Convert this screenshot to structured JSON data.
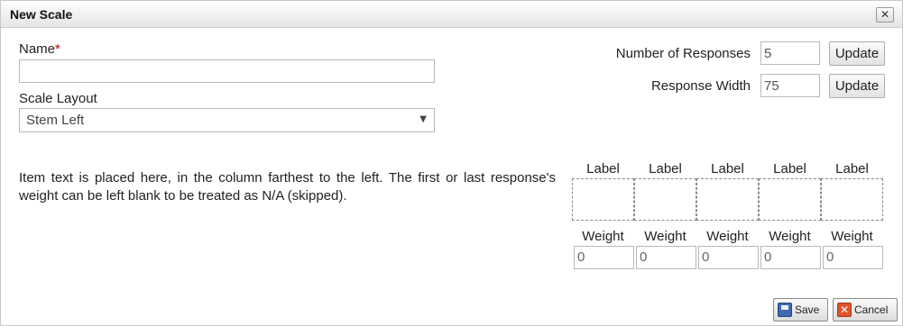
{
  "dialog": {
    "title": "New Scale",
    "close_glyph": "✕"
  },
  "form": {
    "name_label": "Name",
    "required_marker": "*",
    "name_value": "",
    "layout_label": "Scale Layout",
    "layout_selected": "Stem Left",
    "layout_caret": "▼"
  },
  "settings": {
    "responses_label": "Number of Responses",
    "responses_value": "5",
    "width_label": "Response Width",
    "width_value": "75",
    "update_label": "Update"
  },
  "description": "Item text is placed here, in the column farthest to the left. The first or last response's weight can be left blank to be treated as N/A (skipped).",
  "responses": {
    "label_header": "Label",
    "weight_header": "Weight",
    "items": [
      {
        "label": "",
        "weight": "0"
      },
      {
        "label": "",
        "weight": "0"
      },
      {
        "label": "",
        "weight": "0"
      },
      {
        "label": "",
        "weight": "0"
      },
      {
        "label": "",
        "weight": "0"
      }
    ]
  },
  "footer": {
    "save_label": "Save",
    "cancel_label": "Cancel",
    "cancel_glyph": "✕"
  },
  "icons": {
    "save": "save-icon",
    "cancel": "cancel-icon",
    "close": "close-icon"
  }
}
